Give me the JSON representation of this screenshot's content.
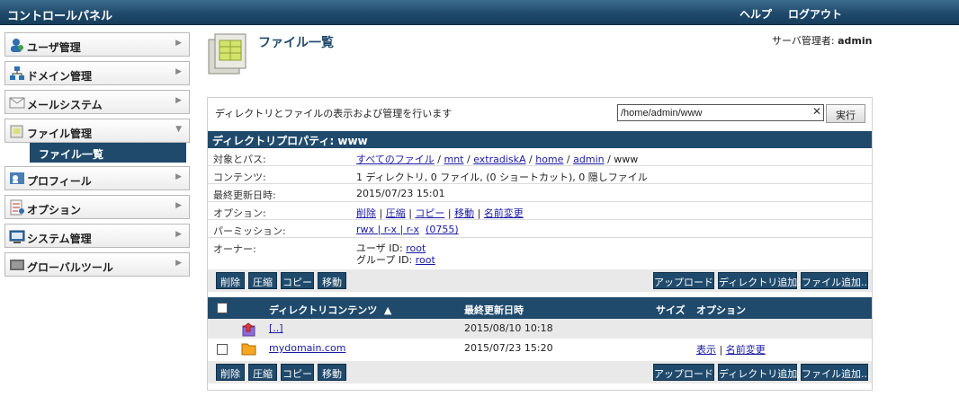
{
  "app": {
    "title": "コントロールパネル",
    "help": "ヘルプ",
    "logout": "ログアウト"
  },
  "sidebar": {
    "items": [
      {
        "label": "ユーザ管理",
        "icon": "user-icon"
      },
      {
        "label": "ドメイン管理",
        "icon": "domain-icon"
      },
      {
        "label": "メールシステム",
        "icon": "mail-icon"
      },
      {
        "label": "ファイル管理",
        "icon": "folder-icon"
      },
      {
        "label": "プロフィール",
        "icon": "profile-icon"
      },
      {
        "label": "オプション",
        "icon": "options-icon"
      },
      {
        "label": "システム管理",
        "icon": "system-icon"
      },
      {
        "label": "グローバルツール",
        "icon": "tools-icon"
      }
    ],
    "sub_item": "ファイル一覧"
  },
  "page": {
    "title": "ファイル一覧",
    "server_admin_label": "サーバ管理者:",
    "server_admin_user": "admin"
  },
  "panel": {
    "description": "ディレクトリとファイルの表示および管理を行います",
    "search_value": "/home/admin/www",
    "run_label": "実行",
    "prop_header": "ディレクトリプロパティ: www",
    "props": {
      "path_label": "対象とパス:",
      "path_links": [
        "すべてのファイル",
        "mnt",
        "extradiskA",
        "home",
        "admin"
      ],
      "path_current": "www",
      "contents_label": "コンテンツ:",
      "contents_value": "1 ディレクトリ, 0 ファイル, (0 ショートカット), 0 隠しファイル",
      "modified_label": "最終更新日時:",
      "modified_value": "2015/07/23 15:01",
      "options_label": "オプション:",
      "options_links": [
        "削除",
        "圧縮",
        "コピー",
        "移動",
        "名前変更"
      ],
      "permission_label": "パーミッション:",
      "permission_link": "rwx | r-x | r-x",
      "permission_octal": "(0755)",
      "owner_label": "オーナー:",
      "owner_user_label": "ユーザ ID:",
      "owner_user": "root",
      "owner_group_label": "グループ ID:",
      "owner_group": "root"
    },
    "actions": {
      "delete": "削除",
      "compress": "圧縮",
      "copy": "コピー",
      "move": "移動",
      "upload": "アップロード...",
      "add_dir": "ディレクトリ追加...",
      "add_file": "ファイル追加..."
    },
    "list": {
      "col_contents": "ディレクトリコンテンツ",
      "col_modified": "最終更新日時",
      "col_size": "サイズ",
      "col_options": "オプション",
      "rows": [
        {
          "name": "[..]",
          "modified": "2015/08/10 10:18",
          "options": []
        },
        {
          "name": "mydomain.com",
          "modified": "2015/07/23 15:20",
          "options": [
            "表示",
            "名前変更"
          ]
        }
      ]
    }
  },
  "colors": {
    "accent": "#1f4a6c",
    "link": "#1a1aa6"
  }
}
